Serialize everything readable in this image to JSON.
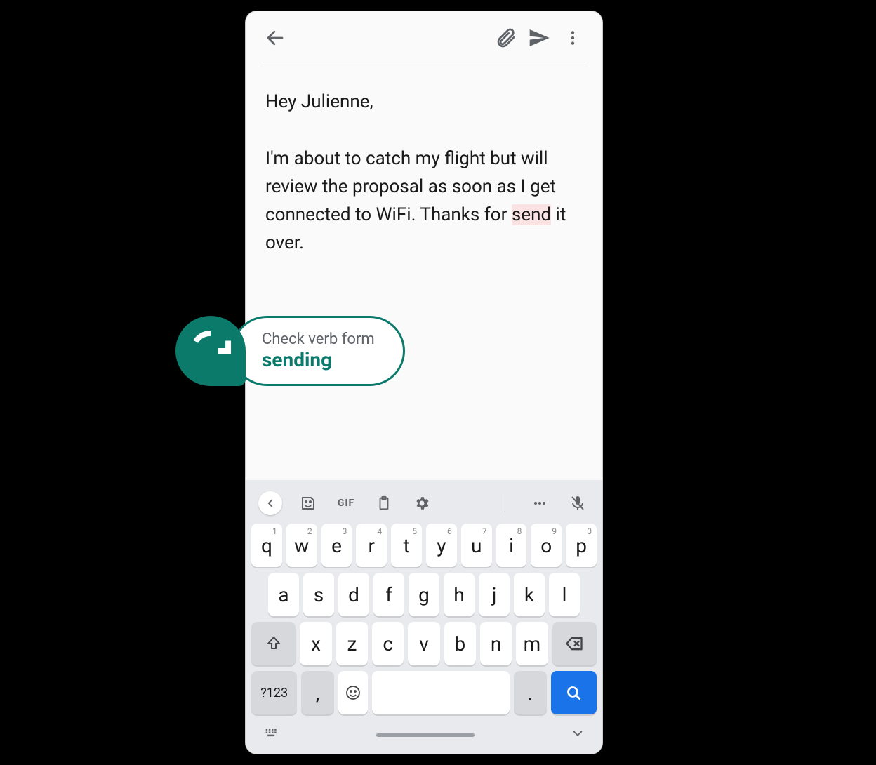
{
  "toolbar": {
    "back": "back",
    "attach": "attach",
    "send": "send",
    "more": "more"
  },
  "compose": {
    "greeting": "Hey Julienne,",
    "body_before": "I'm about to catch my flight but will review the proposal as soon as I get connected to WiFi. Thanks for ",
    "error_word": "send",
    "body_after": " it over."
  },
  "suggestion": {
    "title": "Check verb form",
    "word": "sending"
  },
  "keyboard": {
    "toolbar": {
      "chevron": "<",
      "sticker": "sticker",
      "gif": "GIF",
      "clipboard": "clipboard",
      "settings": "settings",
      "more": "…",
      "mic": "mic-off"
    },
    "row1": [
      {
        "k": "q",
        "n": "1"
      },
      {
        "k": "w",
        "n": "2"
      },
      {
        "k": "e",
        "n": "3"
      },
      {
        "k": "r",
        "n": "4"
      },
      {
        "k": "t",
        "n": "5"
      },
      {
        "k": "y",
        "n": "6"
      },
      {
        "k": "u",
        "n": "7"
      },
      {
        "k": "i",
        "n": "8"
      },
      {
        "k": "o",
        "n": "9"
      },
      {
        "k": "p",
        "n": "0"
      }
    ],
    "row2": [
      "a",
      "s",
      "d",
      "f",
      "g",
      "h",
      "j",
      "k",
      "l"
    ],
    "row3": [
      "x",
      "z",
      "c",
      "v",
      "b",
      "n",
      "m"
    ],
    "shift": "shift",
    "backspace": "backspace",
    "symbols": "?123",
    "comma": ",",
    "emoji": "emoji",
    "period": ".",
    "search": "search"
  }
}
